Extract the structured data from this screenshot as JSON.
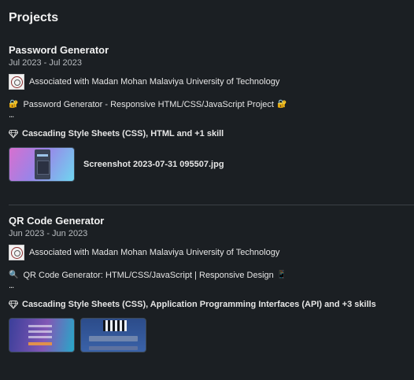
{
  "section": {
    "title": "Projects"
  },
  "projects": [
    {
      "name": "Password Generator",
      "dates": "Jul 2023 - Jul 2023",
      "association": "Associated with Madan Mohan Malaviya University of Technology",
      "description": "Password Generator - Responsive HTML/CSS/JavaScript Project",
      "description_emoji_before": "🔐",
      "description_emoji_after": "🔐",
      "more": "...",
      "skills": "Cascading Style Sheets (CSS), HTML and +1 skill",
      "media_label": "Screenshot 2023-07-31 095507.jpg"
    },
    {
      "name": "QR Code Generator",
      "dates": "Jun 2023 - Jun 2023",
      "association": "Associated with Madan Mohan Malaviya University of Technology",
      "description": "QR Code Generator: HTML/CSS/JavaScript | Responsive Design",
      "description_emoji_before": "🔍",
      "description_emoji_after": "📱",
      "more": "...",
      "skills": "Cascading Style Sheets (CSS), Application Programming Interfaces (API) and +3 skills"
    }
  ],
  "icons": {
    "skills": "gem-icon",
    "association": "university-logo"
  }
}
